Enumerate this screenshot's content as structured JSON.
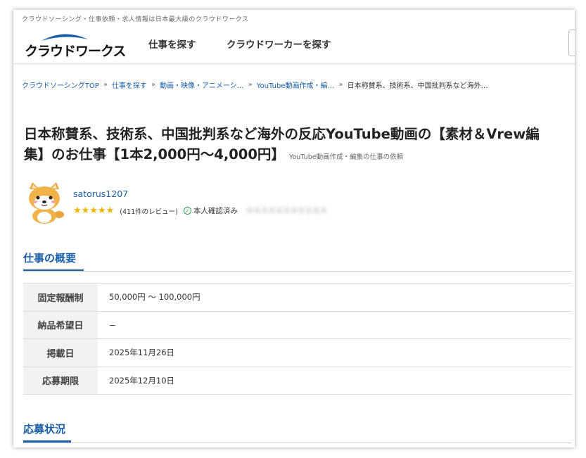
{
  "header": {
    "tagline": "クラウドソーシング・仕事依頼・求人情報は日本最大級のクラウドワークス",
    "logo_text": "クラウドワークス",
    "nav": [
      "仕事を探す",
      "クラウドワーカーを探す"
    ]
  },
  "breadcrumb": [
    {
      "label": "クラウドソーシングTOP",
      "link": true
    },
    {
      "label": "仕事を探す",
      "link": true
    },
    {
      "label": "動画・映像・アニメーシ…",
      "link": true
    },
    {
      "label": "YouTube動画作成・編…",
      "link": true
    },
    {
      "label": "日本称賛系、技術系、中国批判系など海外…",
      "link": false
    }
  ],
  "job": {
    "title": "日本称賛系、技術系、中国批判系など海外の反応YouTube動画の【素材＆Vrew編集】のお仕事【1本2,000円〜4,000円】",
    "category": "YouTube動画作成・編集の仕事の依頼"
  },
  "client": {
    "username": "satorus1207",
    "stars": "★★★★★",
    "rating": 5,
    "review_count": "(411件のレビュー)",
    "verified_label": "本人確認済み",
    "blurred_text": "ＸＸＸＸＸＸＸＸＸＸＸ"
  },
  "summary": {
    "heading": "仕事の概要",
    "rows": [
      {
        "label": "固定報酬制",
        "value": "50,000円 〜 100,000円"
      },
      {
        "label": "納品希望日",
        "value": "−"
      },
      {
        "label": "掲載日",
        "value": "2025年11月26日"
      },
      {
        "label": "応募期限",
        "value": "2025年12月10日"
      }
    ]
  },
  "application": {
    "heading": "応募状況"
  },
  "colors": {
    "link": "#1a5fa8",
    "star": "#f0b400",
    "verified": "#2e9a4a",
    "table_header_bg": "#f2f2f2"
  }
}
